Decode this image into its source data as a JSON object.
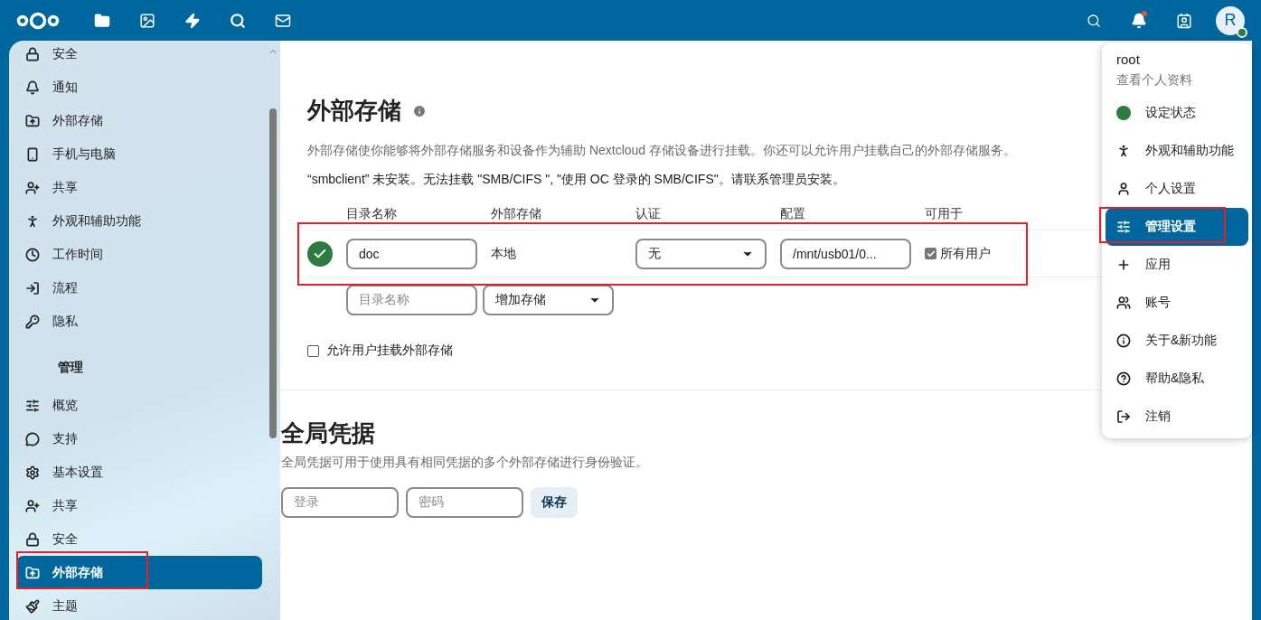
{
  "header": {
    "notifications_unread": true,
    "avatar_letter": "R",
    "online": true
  },
  "sidebar": {
    "sections": [
      {
        "items": [
          {
            "label": "安全",
            "selected": false
          },
          {
            "label": "通知",
            "selected": false
          },
          {
            "label": "外部存储",
            "selected": false
          },
          {
            "label": "手机与电脑",
            "selected": false
          },
          {
            "label": "共享",
            "selected": false
          },
          {
            "label": "外观和辅助功能",
            "selected": false
          },
          {
            "label": "工作时间",
            "selected": false
          },
          {
            "label": "流程",
            "selected": false
          },
          {
            "label": "隐私",
            "selected": false
          }
        ]
      },
      {
        "heading": "管理",
        "items": [
          {
            "label": "概览",
            "selected": false
          },
          {
            "label": "支持",
            "selected": false
          },
          {
            "label": "基本设置",
            "selected": false
          },
          {
            "label": "共享",
            "selected": false
          },
          {
            "label": "安全",
            "selected": false
          },
          {
            "label": "外部存储",
            "selected": true
          },
          {
            "label": "主题",
            "selected": false
          }
        ]
      }
    ]
  },
  "external_storage": {
    "title": "外部存储",
    "description": "外部存储使你能够将外部存储服务和设备作为辅助 Nextcloud 存储设备进行挂载。你还可以允许用户挂载自己的外部存储服务。",
    "warning": "“smbclient” 未安装。无法挂载 \"SMB/CIFS \", \"使用 OC 登录的 SMB/CIFS\"。请联系管理员安装。",
    "columns": [
      "目录名称",
      "外部存储",
      "认证",
      "配置",
      "可用于"
    ],
    "rows": [
      {
        "status_ok": true,
        "folder": "doc",
        "storage": "本地",
        "auth": "无",
        "config": "/mnt/usb01/0...",
        "available": {
          "label": "所有用户",
          "checked": true
        }
      }
    ],
    "add_row": {
      "folder_placeholder": "目录名称",
      "storage_select": "增加存储"
    },
    "allow_user_mount": {
      "label": "允许用户挂载外部存储",
      "checked": false
    }
  },
  "global_credentials": {
    "title": "全局凭据",
    "description": "全局凭据可用于使用具有相同凭据的多个外部存储进行身份验证。",
    "login_placeholder": "登录",
    "password_placeholder": "密码",
    "save": "保存"
  },
  "user_menu": {
    "username": "root",
    "profile_link": "查看个人资料",
    "items": [
      {
        "label": "设定状态",
        "selected": false
      },
      {
        "label": "外观和辅助功能",
        "selected": false
      },
      {
        "label": "个人设置",
        "selected": false
      },
      {
        "label": "管理设置",
        "selected": true
      },
      {
        "label": "应用",
        "selected": false
      },
      {
        "label": "账号",
        "selected": false
      },
      {
        "label": "关于&新功能",
        "selected": false
      },
      {
        "label": "帮助&隐私",
        "selected": false
      },
      {
        "label": "注销",
        "selected": false
      }
    ]
  }
}
